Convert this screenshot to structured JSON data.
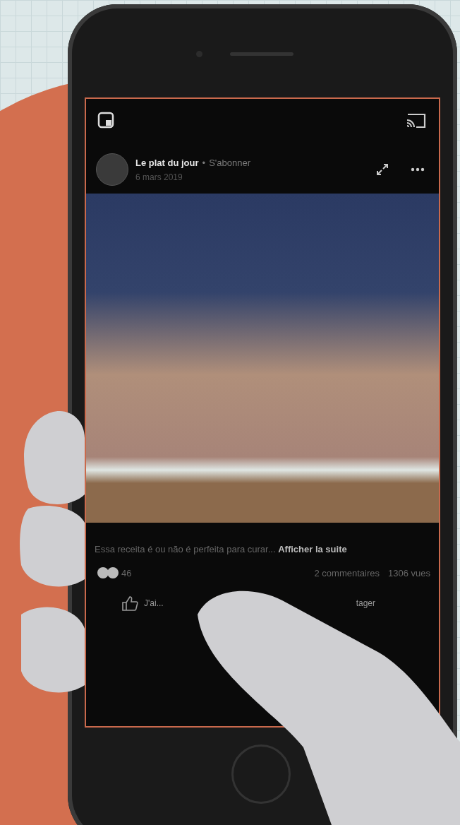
{
  "post": {
    "author": "Le plat du jour",
    "separator": "•",
    "subscribe": "S'abonner",
    "date": "6 mars 2019",
    "caption": "Essa receita é ou não é perfeita para curar...",
    "more": "Afficher la suite",
    "reaction_count": "46",
    "comments": "2 commentaires",
    "views": "1306 vues",
    "actions": [
      {
        "kind": "like",
        "label": "J'ai..."
      },
      {
        "kind": "share",
        "label": "tager"
      }
    ]
  }
}
